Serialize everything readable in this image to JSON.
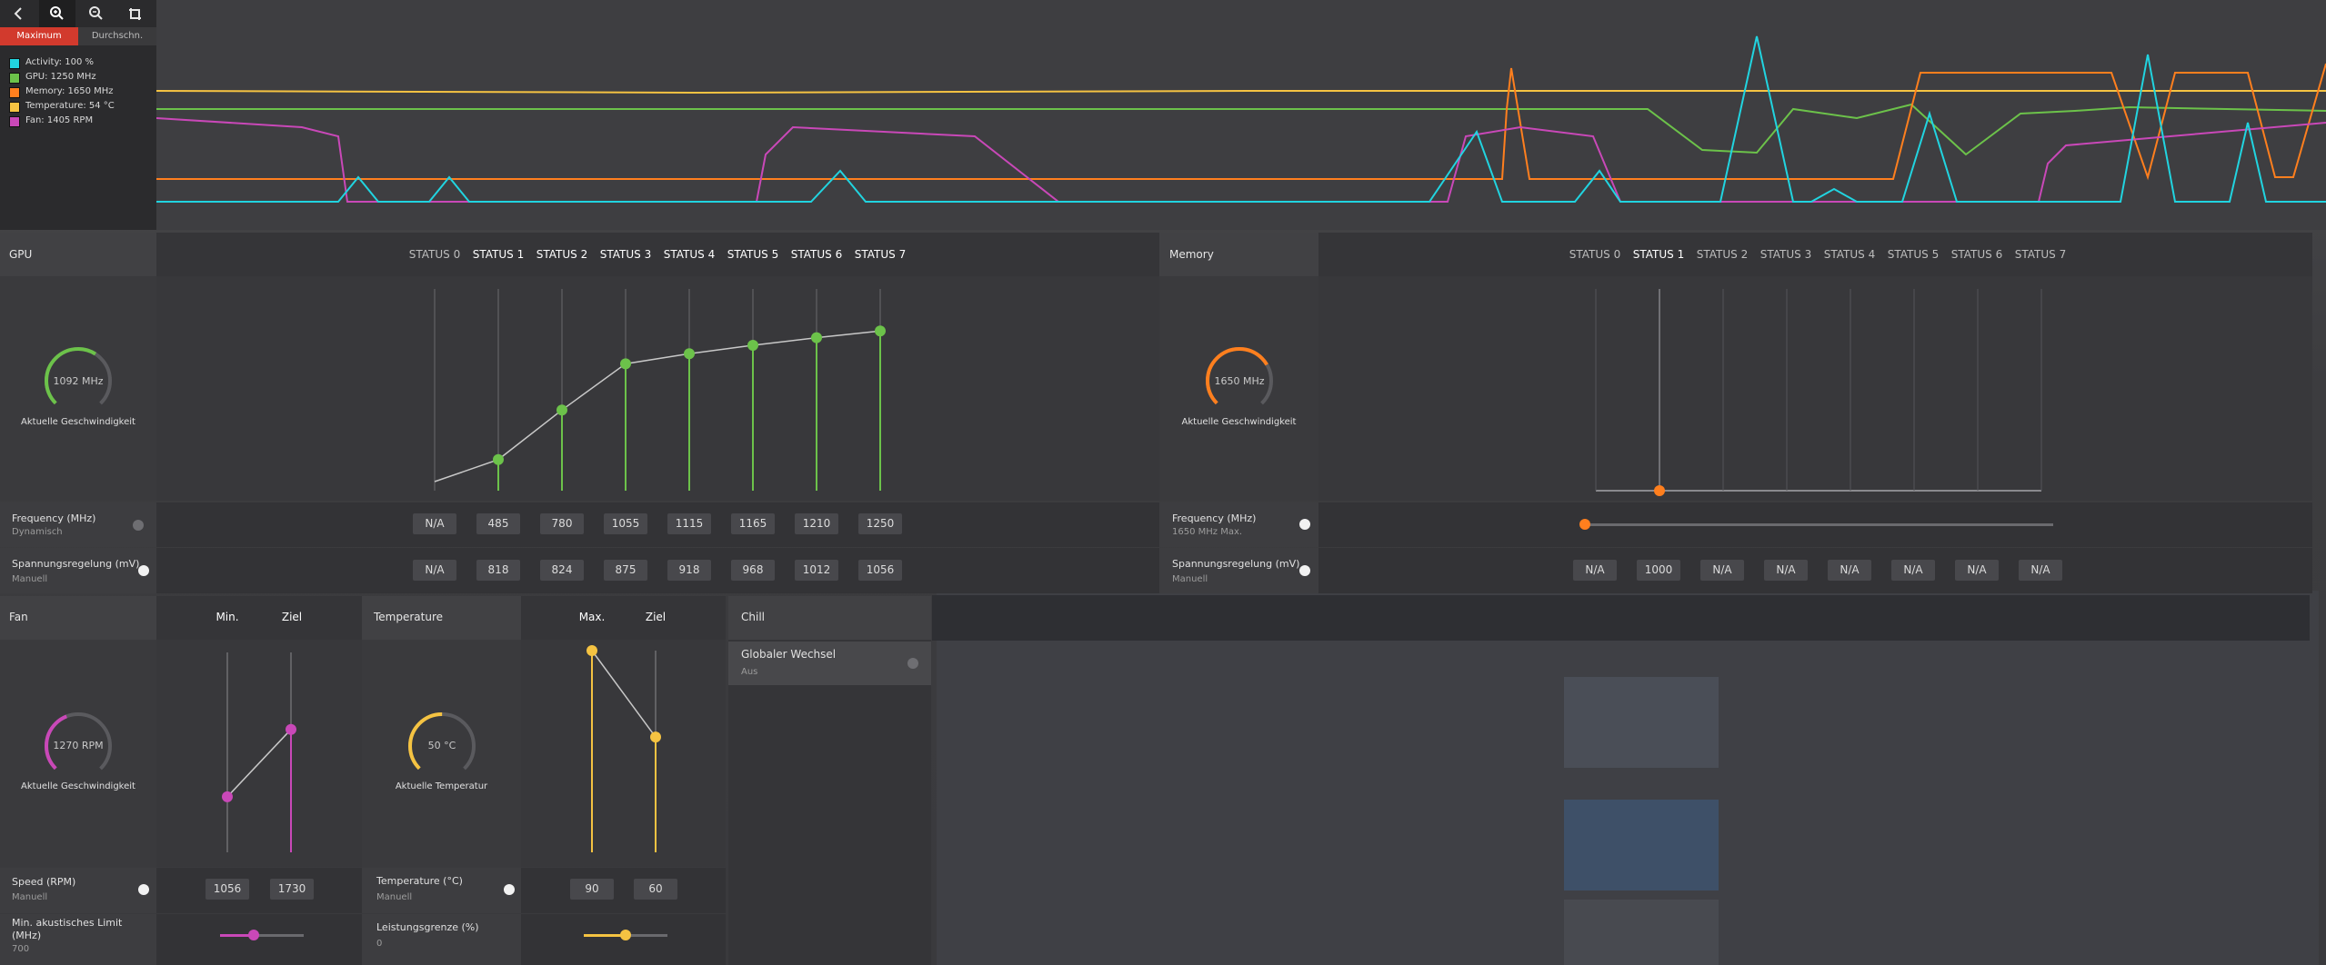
{
  "toolbar": {
    "back_icon": "chevron-left-icon",
    "zoom_in_icon": "zoom-in-icon",
    "zoom_out_icon": "zoom-out-icon",
    "crop_icon": "crop-icon",
    "tab_max": "Maximum",
    "tab_avg": "Durchschn."
  },
  "legend": [
    {
      "label": "Activity: 100 %",
      "color": "#21d4e0"
    },
    {
      "label": "GPU: 1250 MHz",
      "color": "#6cc24a"
    },
    {
      "label": "Memory: 1650 MHz",
      "color": "#ff7f1e"
    },
    {
      "label": "Temperature: 54 °C",
      "color": "#f5c342"
    },
    {
      "label": "Fan: 1405 RPM",
      "color": "#c948b8"
    }
  ],
  "gpu": {
    "title": "GPU",
    "gauge_value": "1092 MHz",
    "gauge_label": "Aktuelle Geschwindigkeit",
    "gauge_fraction": 0.62,
    "gauge_color": "#6cc24a",
    "states": [
      "STATUS 0",
      "STATUS 1",
      "STATUS 2",
      "STATUS 3",
      "STATUS 4",
      "STATUS 5",
      "STATUS 6",
      "STATUS 7"
    ],
    "freq_label": "Frequency (MHz)",
    "freq_sub": "Dynamisch",
    "freq_values": [
      "N/A",
      "485",
      "780",
      "1055",
      "1115",
      "1165",
      "1210",
      "1250"
    ],
    "volt_label": "Spannungsregelung (mV)",
    "volt_sub": "Manuell",
    "volt_values": [
      "N/A",
      "818",
      "824",
      "875",
      "918",
      "968",
      "1012",
      "1056"
    ]
  },
  "memory": {
    "title": "Memory",
    "gauge_value": "1650 MHz",
    "gauge_label": "Aktuelle Geschwindigkeit",
    "gauge_fraction": 0.72,
    "gauge_color": "#ff7f1e",
    "states": [
      "STATUS 0",
      "STATUS 1",
      "STATUS 2",
      "STATUS 3",
      "STATUS 4",
      "STATUS 5",
      "STATUS 6",
      "STATUS 7"
    ],
    "freq_label": "Frequency (MHz)",
    "freq_sub": "1650 MHz Max.",
    "volt_label": "Spannungsregelung (mV)",
    "volt_sub": "Manuell",
    "volt_values": [
      "N/A",
      "1000",
      "N/A",
      "N/A",
      "N/A",
      "N/A",
      "N/A",
      "N/A"
    ]
  },
  "fan": {
    "title": "Fan",
    "col_min": "Min.",
    "col_target": "Ziel",
    "gauge_value": "1270 RPM",
    "gauge_label": "Aktuelle Geschwindigkeit",
    "gauge_fraction": 0.42,
    "gauge_color": "#c948b8",
    "speed_label": "Speed (RPM)",
    "speed_sub": "Manuell",
    "speed_min": "1056",
    "speed_target": "1730",
    "limit_label": "Min. akustisches Limit",
    "limit_label2": "(MHz)",
    "limit_sub": "700",
    "limit_fraction": 0.4
  },
  "temperature": {
    "title": "Temperature",
    "col_max": "Max.",
    "col_target": "Ziel",
    "gauge_value": "50 °C",
    "gauge_label": "Aktuelle Temperatur",
    "gauge_fraction": 0.5,
    "gauge_color": "#f5c342",
    "temp_label": "Temperature (°C)",
    "temp_sub": "Manuell",
    "temp_max": "90",
    "temp_target": "60",
    "power_label": "Leistungsgrenze (%)",
    "power_sub": "0",
    "power_fraction": 0.5
  },
  "chill": {
    "title": "Chill",
    "global_label": "Globaler Wechsel",
    "global_sub": "Aus"
  }
}
